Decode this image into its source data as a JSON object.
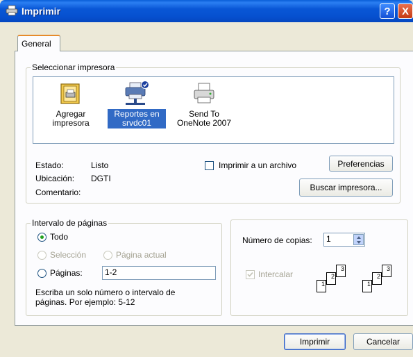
{
  "window": {
    "title": "Imprimir",
    "help_glyph": "?",
    "close_glyph": "X"
  },
  "tabs": [
    {
      "label": "General"
    }
  ],
  "printer_group": {
    "title": "Seleccionar impresora",
    "printers": [
      {
        "line1": "Agregar",
        "line2": "impresora",
        "icon": "add-printer-icon",
        "selected": false
      },
      {
        "line1": "Reportes en",
        "line2": "srvdc01",
        "icon": "network-printer-icon",
        "selected": true
      },
      {
        "line1": "Send To",
        "line2": "OneNote 2007",
        "icon": "printer-icon",
        "selected": false
      }
    ],
    "status_label": "Estado:",
    "status_value": "Listo",
    "location_label": "Ubicación:",
    "location_value": "DGTI",
    "comment_label": "Comentario:",
    "print_to_file_label": "Imprimir a un archivo",
    "preferences_button": "Preferencias",
    "find_printer_button": "Buscar impresora..."
  },
  "page_range": {
    "title": "Intervalo de páginas",
    "all_label": "Todo",
    "selection_label": "Selección",
    "current_page_label": "Página actual",
    "pages_label": "Páginas:",
    "pages_value": "1-2",
    "hint_line1": "Escriba un solo número o intervalo de",
    "hint_line2": "páginas. Por ejemplo: 5-12"
  },
  "copies": {
    "label": "Número de copias:",
    "value": "1",
    "collate_label": "Intercalar",
    "collate_pages": [
      "1",
      "2",
      "3"
    ]
  },
  "footer": {
    "print_button": "Imprimir",
    "cancel_button": "Cancelar"
  },
  "colors": {
    "titlebar": "#0a5fd8",
    "selection": "#316ac5",
    "tab_accent": "#e68b2c"
  }
}
